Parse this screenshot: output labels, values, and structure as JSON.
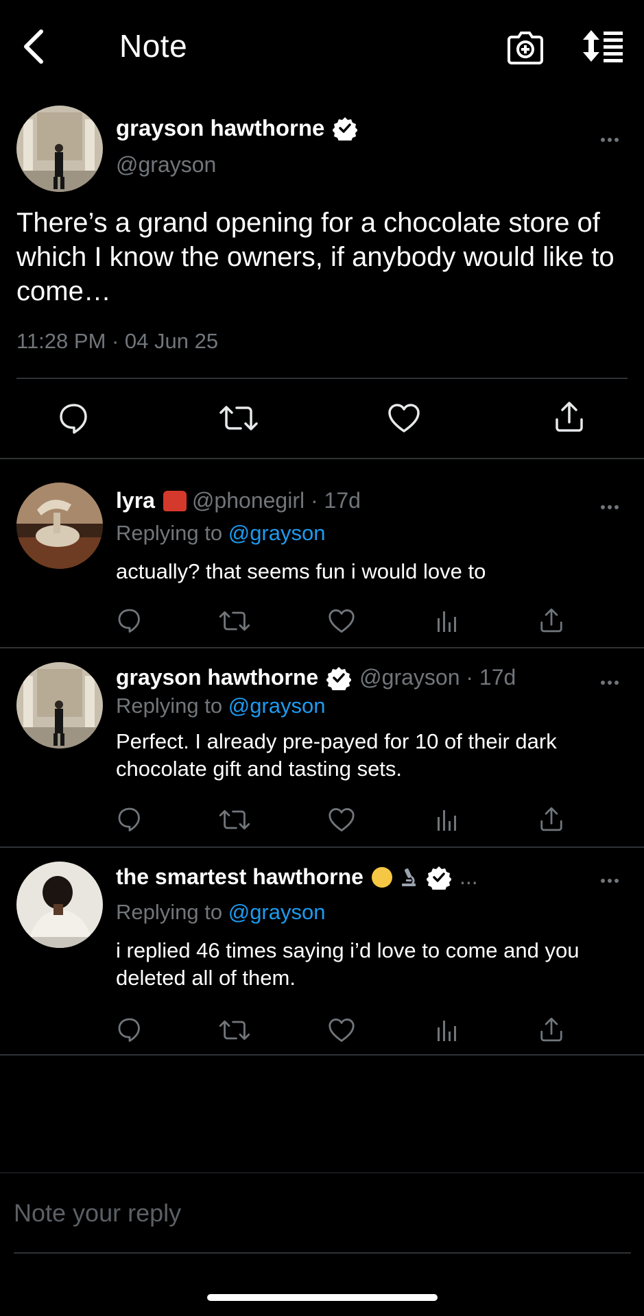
{
  "header": {
    "title": "Note",
    "back_icon": "chevron-left-icon",
    "camera_icon": "camera-plus-icon",
    "sort_icon": "sort-list-icon"
  },
  "main_post": {
    "author_name": "grayson hawthorne",
    "verified": true,
    "handle": "@grayson",
    "text": "There’s a grand opening for a chocolate store of which I know the owners, if anybody would like to come…",
    "timestamp": "11:28 PM · 04 Jun 25",
    "actions": [
      "reply-icon",
      "repost-icon",
      "like-icon",
      "share-icon"
    ]
  },
  "replies": [
    {
      "author_name": "lyra",
      "emoji": "☎",
      "handle": "@phonegirl",
      "time": "17d",
      "replying_prefix": "Replying to",
      "replying_to": "@grayson",
      "text": "actually? that seems fun i would love to"
    },
    {
      "author_name": "grayson hawthorne",
      "verified": true,
      "handle": "@grayson",
      "time": "17d",
      "replying_prefix": "Replying to",
      "replying_to": "@grayson",
      "text": "Perfect. I already pre-payed for 10 of their dark chocolate gift and tasting sets."
    },
    {
      "author_name": "the smartest hawthorne",
      "emoji_1": "🤓",
      "emoji_2": "🔬",
      "verified": true,
      "ellipsis": "...",
      "replying_prefix": "Replying to",
      "replying_to": "@grayson",
      "text": "i replied 46 times saying i’d love to come and you deleted all of them."
    }
  ],
  "compose": {
    "placeholder": "Note your reply"
  },
  "colors": {
    "background": "#000000",
    "text": "#e7e9ea",
    "secondary": "#71767b",
    "accent": "#1d9bf0",
    "divider": "#2f3336"
  }
}
